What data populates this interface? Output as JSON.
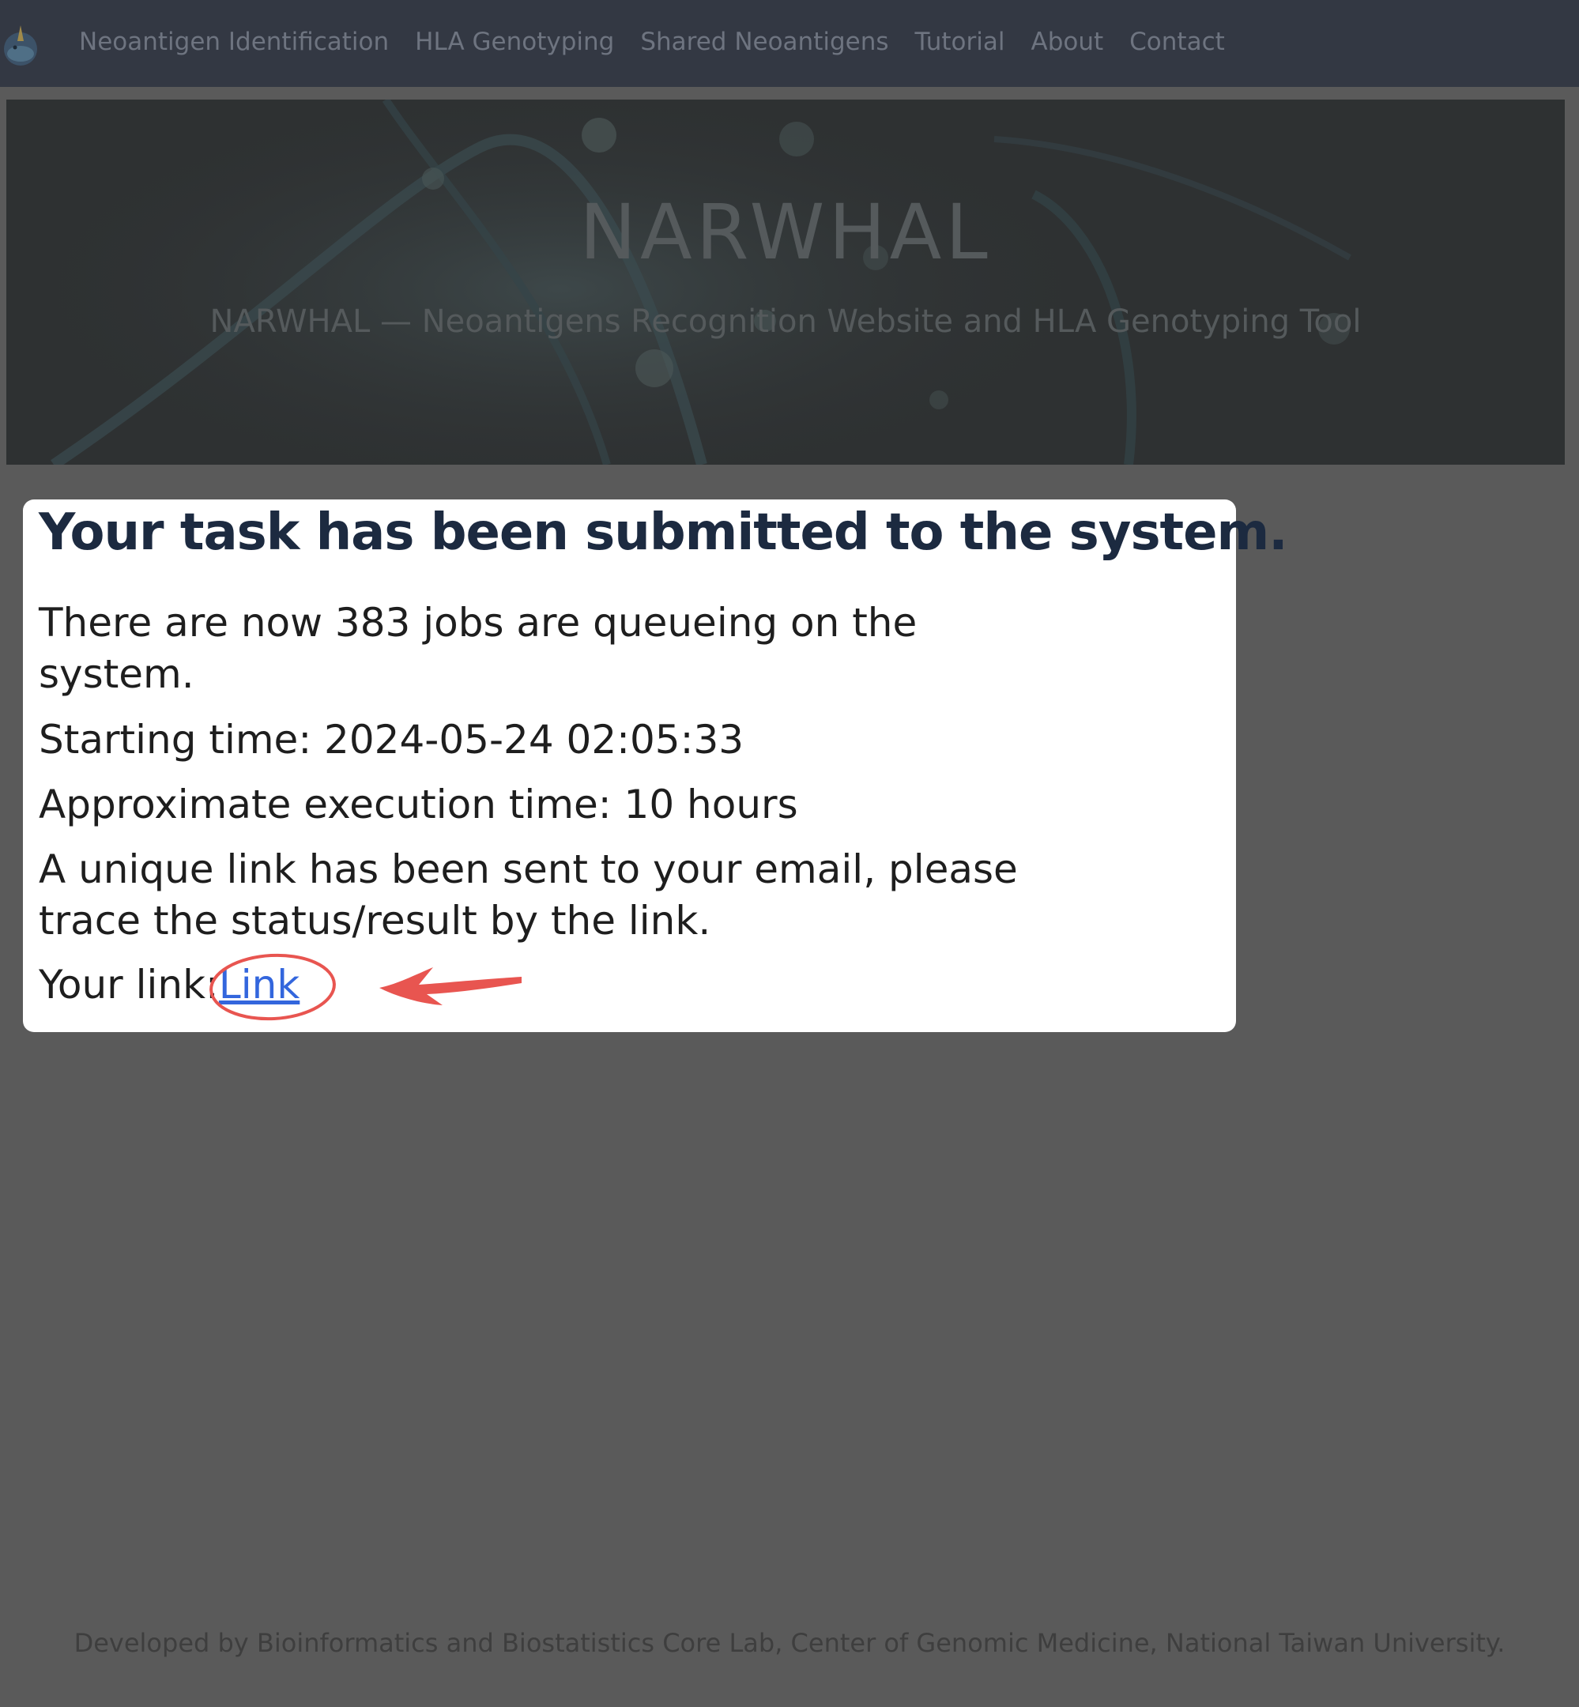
{
  "nav": {
    "logo_icon": "narwhal-logo-icon",
    "items": [
      {
        "label": "Neoantigen Identification"
      },
      {
        "label": "HLA Genotyping"
      },
      {
        "label": "Shared Neoantigens"
      },
      {
        "label": "Tutorial"
      },
      {
        "label": "About"
      },
      {
        "label": "Contact"
      }
    ]
  },
  "hero": {
    "title": "NARWHAL",
    "subtitle": "NARWHAL — Neoantigens Recognition Website and HLA Genotyping Tool"
  },
  "notice": {
    "title": "Your task has been submitted to the system.",
    "queue_text": "There are now 383 jobs are queueing on the system.",
    "start_text": "Starting time: 2024-05-24 02:05:33",
    "execution_text": "Approximate execution time: 10 hours",
    "email_text": "A unique link has been sent to your email, please trace the status/result by the link.",
    "link_prefix": "Your link:",
    "link_label": "Link"
  },
  "annotation": {
    "color": "#e85550",
    "shapes": [
      "circle",
      "arrow"
    ]
  },
  "footer": {
    "text": "Developed by Bioinformatics and Biostatistics Core Lab, Center of Genomic Medicine, National Taiwan University."
  },
  "colors": {
    "navbar": "#333843",
    "overlay": "#5a5a5a",
    "link": "#3366dd",
    "title": "#1c2a40"
  }
}
